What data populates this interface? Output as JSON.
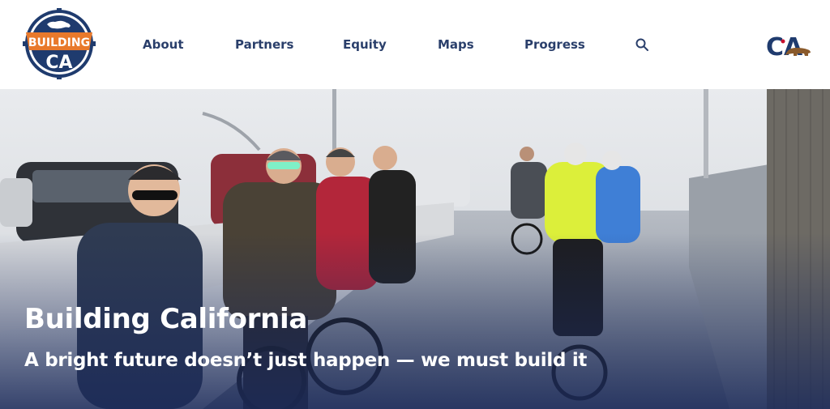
{
  "header": {
    "logo": {
      "top_text": "BUILDING",
      "bottom_text": "CA",
      "icon": "building-ca-badge-logo"
    },
    "nav": [
      {
        "label": "About"
      },
      {
        "label": "Partners"
      },
      {
        "label": "Equity"
      },
      {
        "label": "Maps"
      },
      {
        "label": "Progress"
      }
    ],
    "search_icon": "search-icon",
    "ca_logo": {
      "text": "CA",
      "icon": "california-bear-logo"
    }
  },
  "hero": {
    "title": "Building California",
    "subtitle": "A bright future doesn’t just happen — we must build it",
    "image": "cyclists-riding-on-bridge-bike-lane"
  },
  "colors": {
    "navy": "#1f3b6e",
    "orange": "#e8792b",
    "nav_text": "#2a3f6b"
  }
}
